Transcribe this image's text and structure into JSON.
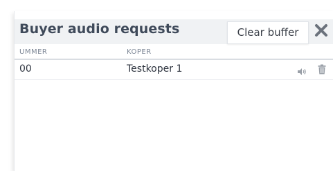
{
  "panel": {
    "title": "Buyer audio requests",
    "clear_button_label": "Clear buffer",
    "close_icon": "close-x-icon"
  },
  "table": {
    "columns": [
      "UMMER",
      "KOPER"
    ],
    "rows": [
      {
        "nummer": "00",
        "koper": "Testkoper 1",
        "actions": [
          "speaker-icon",
          "trash-icon"
        ]
      }
    ]
  },
  "colors": {
    "header_bg": "#f0f2f4",
    "title_text": "#3f4a5a",
    "column_header_text": "#7b8594",
    "icon": "#9aa0a8"
  }
}
